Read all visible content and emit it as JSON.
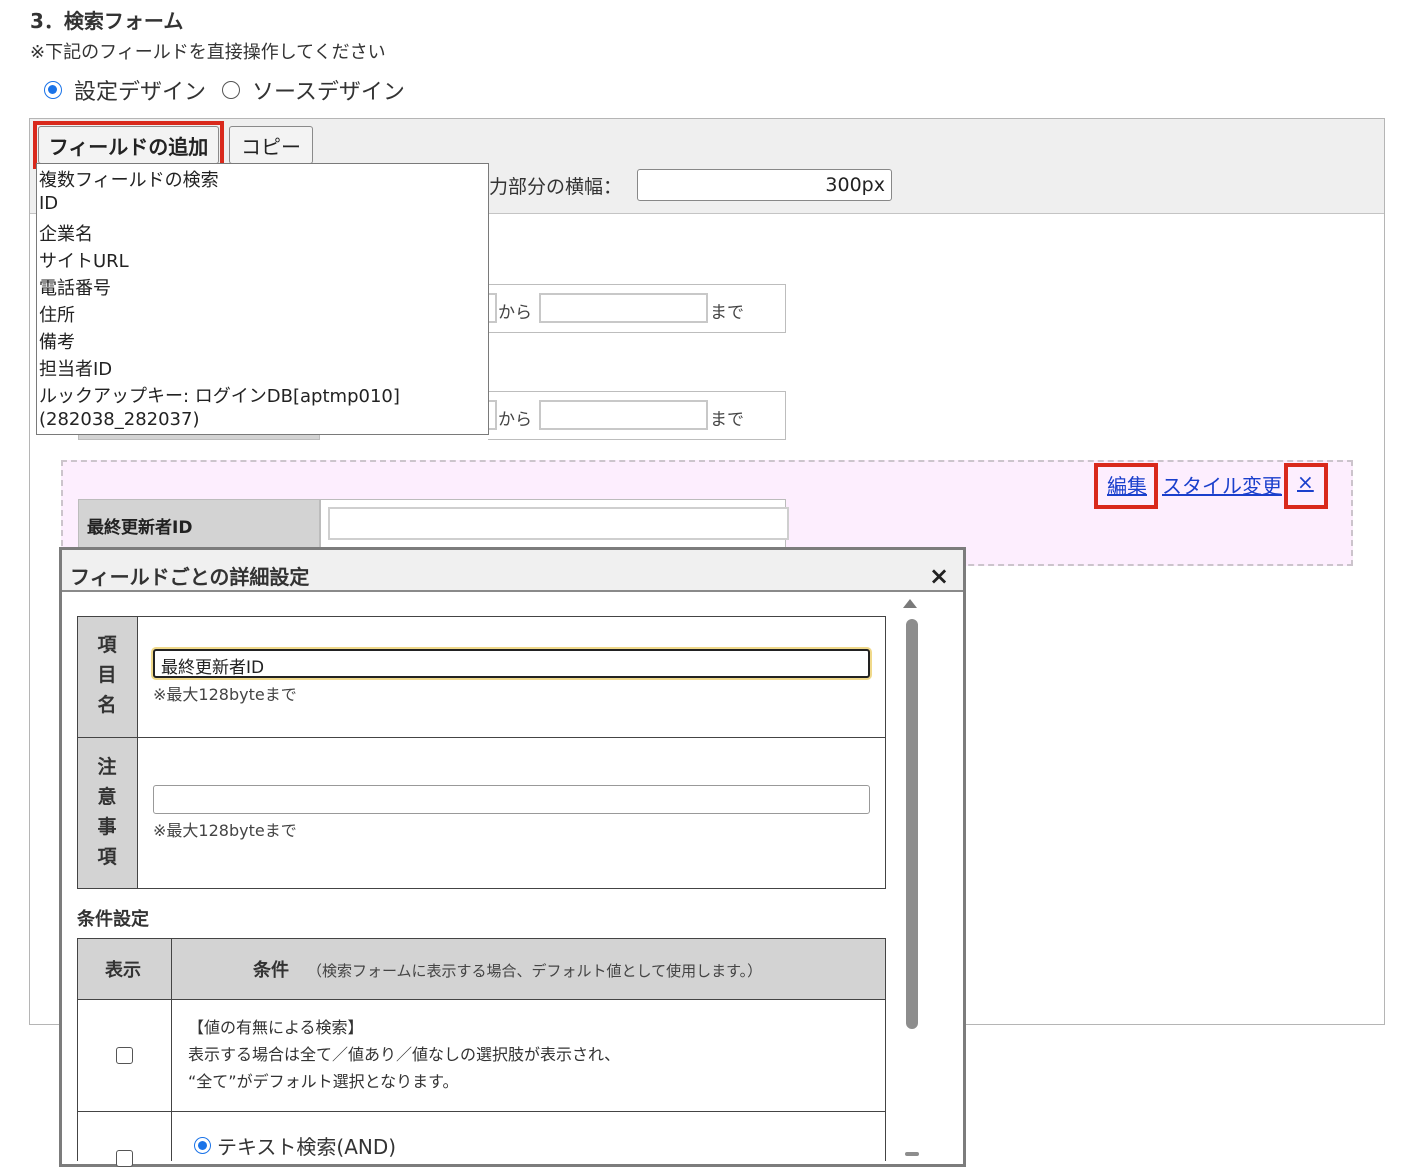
{
  "header": {
    "section_title": "3．検索フォーム",
    "note": "※下記のフィールドを直接操作してください",
    "design_options": [
      {
        "label": "設定デザイン",
        "checked": true
      },
      {
        "label": "ソースデザイン",
        "checked": false
      }
    ]
  },
  "toolbar": {
    "add_field_label": "フィールドの追加",
    "copy_label": "コピー",
    "width_label": "力部分の横幅：",
    "width_value": "300px"
  },
  "dropdown": {
    "items": [
      "複数フィールドの検索",
      "ID",
      "企業名",
      "サイトURL",
      "電話番号",
      "住所",
      "備考",
      "担当者ID",
      "ルックアップキー: ログインDB[aptmp010]",
      "(282038_282037)"
    ]
  },
  "range_rows": [
    {
      "from": "から",
      "to": "まで"
    },
    {
      "from": "から",
      "to": "まで"
    }
  ],
  "field_row": {
    "edit_link": "編集",
    "style_link": "スタイル変更",
    "delete_link": "×",
    "label": "最終更新者ID"
  },
  "dialog": {
    "title": "フィールドごとの詳細設定",
    "close": "×",
    "item_name_label": [
      "項",
      "目",
      "名"
    ],
    "item_name_value": "最終更新者ID",
    "item_name_note": "※最大128byteまで",
    "caution_label": [
      "注",
      "意",
      "事",
      "項"
    ],
    "caution_value": "",
    "caution_note": "※最大128byteまで",
    "condition_heading": "条件設定",
    "table_header_display": "表示",
    "table_header_condition": "条件",
    "table_header_condition_note": "（検索フォームに表示する場合、デフォルト値として使用します。）",
    "row1_lines": [
      "【値の有無による検索】",
      "表示する場合は全て／値あり／値なしの選択肢が表示され、",
      "“全て”がデフォルト選択となります。"
    ],
    "row1_checked": false,
    "row2_option": "テキスト検索(AND)",
    "row2_option_checked": true
  }
}
